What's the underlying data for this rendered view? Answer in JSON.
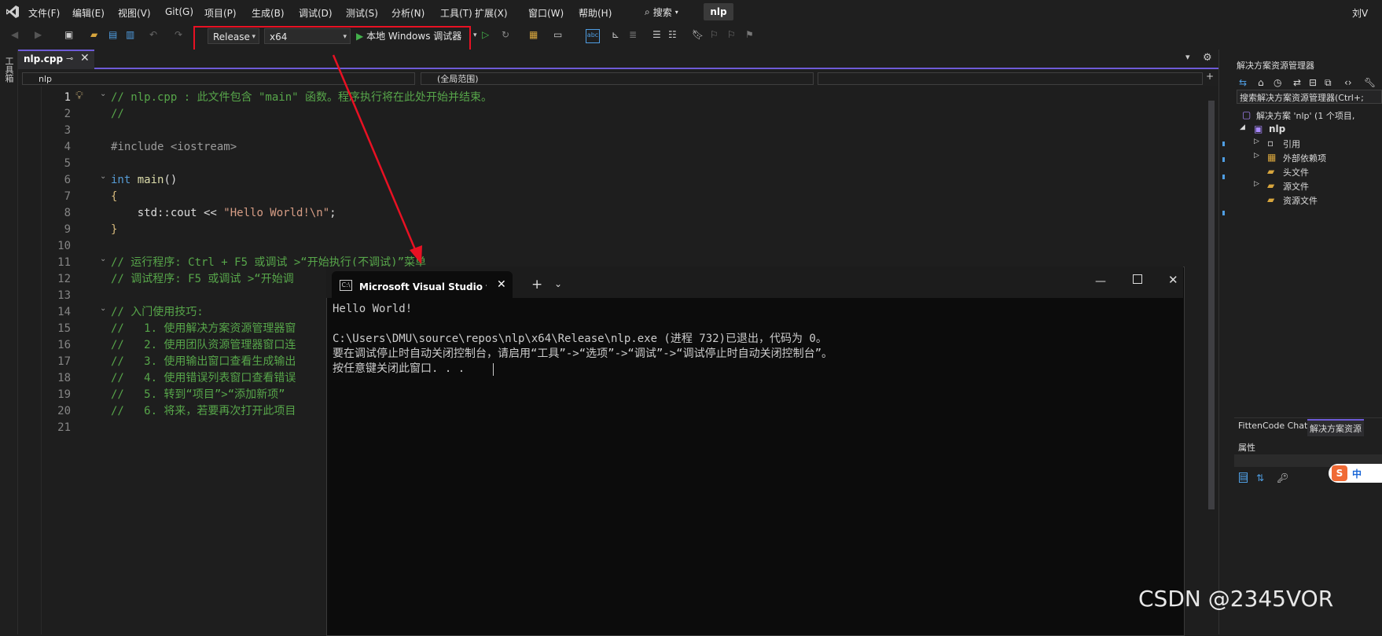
{
  "menu": {
    "items": [
      "文件(F)",
      "编辑(E)",
      "视图(V)",
      "Git(G)",
      "项目(P)",
      "生成(B)",
      "调试(D)",
      "测试(S)",
      "分析(N)",
      "工具(T)",
      "扩展(X)",
      "窗口(W)",
      "帮助(H)"
    ],
    "search_label": "搜索",
    "solution_name": "nlp",
    "user": "刘V"
  },
  "toolbar": {
    "config": "Release",
    "platform": "x64",
    "run_label": "本地 Windows 调试器"
  },
  "toolbox_label": "工具箱",
  "tab": {
    "file_name": "nlp.cpp"
  },
  "nav": {
    "scope_project": "nlp",
    "scope_global": "(全局范围)"
  },
  "editor": {
    "line_numbers": [
      "1",
      "2",
      "3",
      "4",
      "5",
      "6",
      "7",
      "8",
      "9",
      "10",
      "11",
      "12",
      "13",
      "14",
      "15",
      "16",
      "17",
      "18",
      "19",
      "20",
      "21"
    ],
    "lines": {
      "l1": "// nlp.cpp : 此文件包含 \"main\" 函数。程序执行将在此处开始并结束。",
      "l2": "//",
      "l4": "#include <iostream>",
      "l6_kw": "int",
      "l6_fn": "main",
      "l6_rest": "()",
      "l7": "{",
      "l8_a": "    std::cout << ",
      "l8_str": "\"Hello World!\\n\"",
      "l8_end": ";",
      "l9": "}",
      "l11": "// 运行程序: Ctrl + F5 或调试 >“开始执行(不调试)”菜单",
      "l12": "// 调试程序: F5 或调试 >“开始调",
      "l14": "// 入门使用技巧:",
      "l15": "//   1. 使用解决方案资源管理器窗",
      "l16": "//   2. 使用团队资源管理器窗口连",
      "l17": "//   3. 使用输出窗口查看生成输出",
      "l18": "//   4. 使用错误列表窗口查看错误",
      "l19": "//   5. 转到“项目”>“添加新项”",
      "l20": "//   6. 将来，若要再次打开此项目"
    }
  },
  "solution_explorer": {
    "title": "解决方案资源管理器",
    "search_placeholder": "搜索解决方案资源管理器(Ctrl+;",
    "solution": "解决方案 'nlp' (1 个项目,",
    "project": "nlp",
    "nodes": [
      "引用",
      "外部依赖项",
      "头文件",
      "源文件",
      "资源文件"
    ],
    "bottom_tabs": [
      "FittenCode Chat",
      "解决方案资源"
    ],
    "properties_title": "属性",
    "ime_label": "中"
  },
  "console": {
    "title": "Microsoft Visual Studio 调试控",
    "lines": [
      "Hello World!",
      "",
      "C:\\Users\\DMU\\source\\repos\\nlp\\x64\\Release\\nlp.exe (进程 732)已退出，代码为 0。",
      "要在调试停止时自动关闭控制台，请启用“工具”->“选项”->“调试”->“调试停止时自动关闭控制台”。",
      "按任意键关闭此窗口. . ."
    ]
  },
  "watermark": "CSDN @2345VOR",
  "colors": {
    "accent": "#6e5bd7",
    "highlight_box": "#e81123",
    "comment": "#57a64a",
    "keyword": "#569cd6"
  }
}
